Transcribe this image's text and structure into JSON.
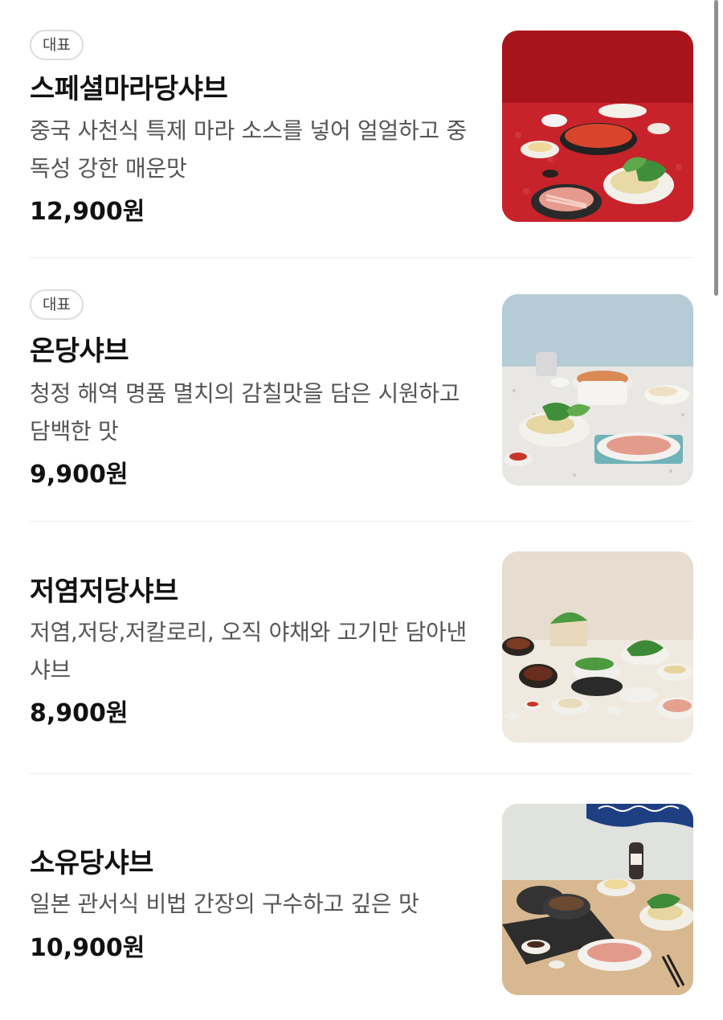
{
  "menu": {
    "items": [
      {
        "badge": "대표",
        "name": "스페셜마라당샤브",
        "description": "중국 사천식 특제 마라 소스를 넣어 얼얼하고 중독성 강한 매운맛",
        "price": "12,900원"
      },
      {
        "badge": "대표",
        "name": "온당샤브",
        "description": "청정 해역 명품 멸치의 감칠맛을 담은 시원하고 담백한 맛",
        "price": "9,900원"
      },
      {
        "name": "저염저당샤브",
        "description": "저염,저당,저칼로리, 오직 야채와 고기만 담아낸 샤브",
        "price": "8,900원"
      },
      {
        "name": "소유당샤브",
        "description": "일본 관서식 비법 간장의 구수하고 깊은 맛",
        "price": "10,900원"
      }
    ]
  }
}
